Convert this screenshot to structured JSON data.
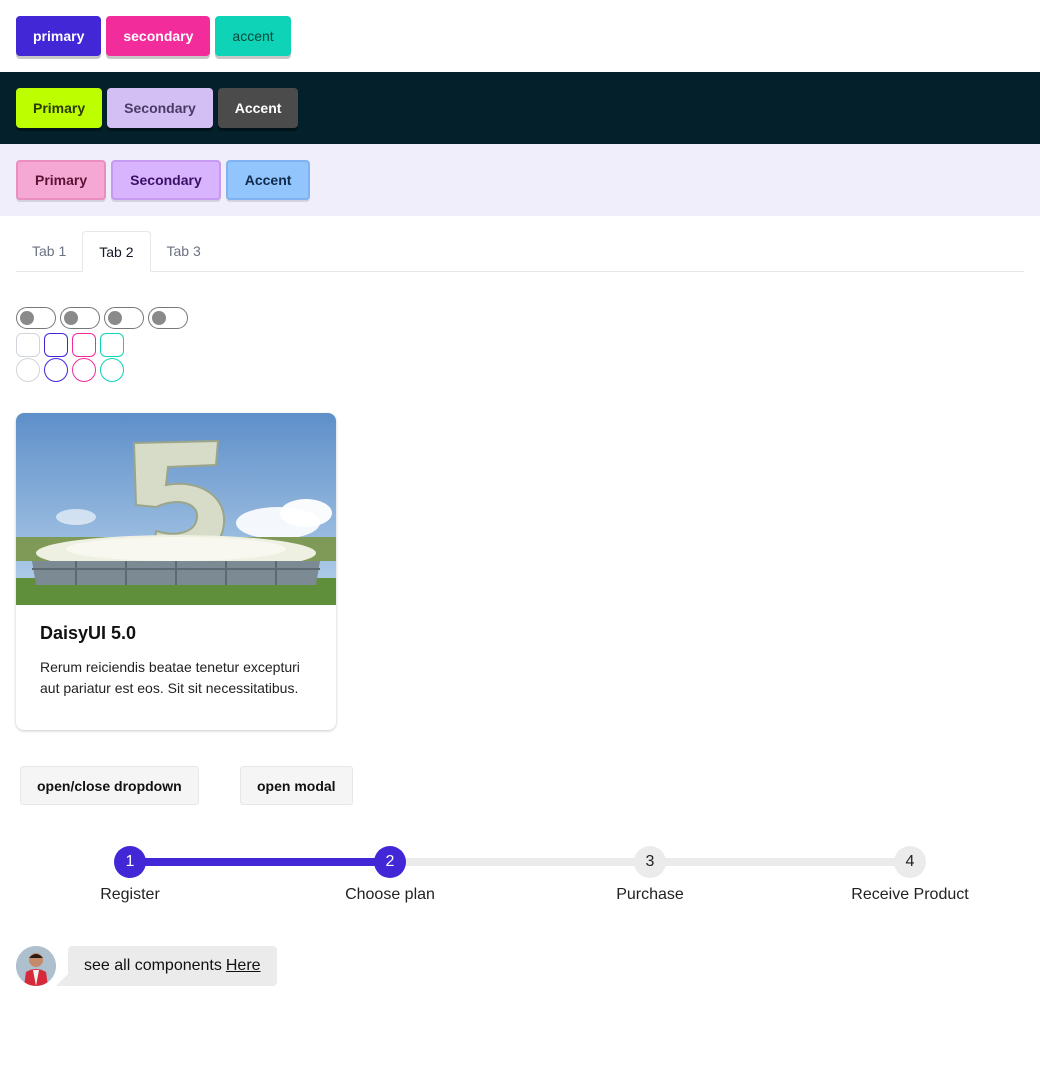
{
  "button_rows": {
    "row1": {
      "primary": "primary",
      "secondary": "secondary",
      "accent": "accent"
    },
    "row2": {
      "primary": "Primary",
      "secondary": "Secondary",
      "accent": "Accent"
    },
    "row3": {
      "primary": "Primary",
      "secondary": "Secondary",
      "accent": "Accent"
    }
  },
  "tabs": [
    {
      "label": "Tab 1",
      "active": false
    },
    {
      "label": "Tab 2",
      "active": true
    },
    {
      "label": "Tab 3",
      "active": false
    }
  ],
  "card": {
    "image_icon": "flower-number-five-image",
    "title": "DaisyUI 5.0",
    "text": "Rerum reiciendis beatae tenetur excepturi aut pariatur est eos. Sit sit necessitatibus."
  },
  "actions": {
    "dropdown": "open/close dropdown",
    "modal": "open modal"
  },
  "steps": [
    {
      "number": "1",
      "label": "Register",
      "done": true
    },
    {
      "number": "2",
      "label": "Choose plan",
      "done": true
    },
    {
      "number": "3",
      "label": "Purchase",
      "done": false
    },
    {
      "number": "4",
      "label": "Receive Product",
      "done": false
    }
  ],
  "chat": {
    "avatar_icon": "user-avatar",
    "text": "see all components",
    "link": "Here"
  },
  "colors": {
    "primary": "#4127d6",
    "secondary": "#f22c9a",
    "accent": "#0ed3b6",
    "dark_bg": "#04212b",
    "light_bg": "#f1eefb"
  }
}
